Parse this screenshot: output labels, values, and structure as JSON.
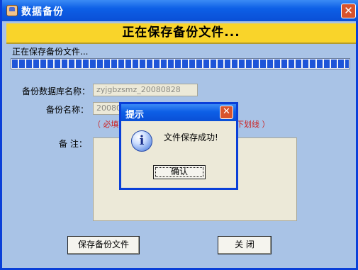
{
  "window": {
    "title": "数据备份",
    "banner": "正在保存备份文件...",
    "status": "正在保存备份文件...",
    "progress_percent": 100
  },
  "form": {
    "db_name_label": "备份数据库名称：",
    "db_name_value": "zyjgbzsmz_20080828",
    "backup_name_label": "备份名称：",
    "backup_name_value": "2008082",
    "hint_left": "（ 必填，",
    "hint_right": "下划线 ）",
    "notes_label": "备  注：",
    "notes_value": ""
  },
  "buttons": {
    "save": "保存备份文件",
    "close": "关  闭"
  },
  "dialog": {
    "title": "提示",
    "message": "文件保存成功!",
    "ok": "确认"
  }
}
